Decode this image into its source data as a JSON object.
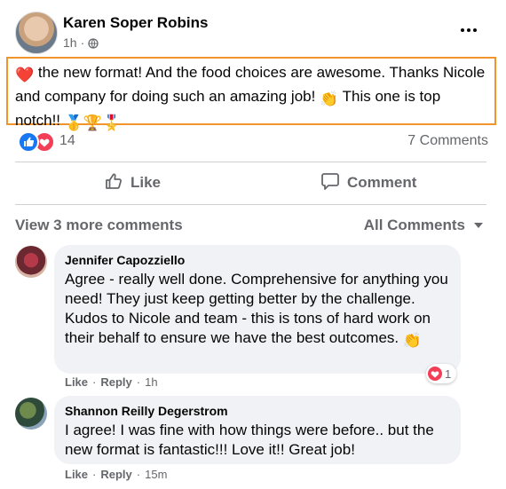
{
  "post": {
    "author": "Karen Soper Robins",
    "time": "1h",
    "separator": "·",
    "text_heart": "❤️",
    "text_part1": " the new format! And the food choices are awesome.  Thanks Nicole and company for doing such an amazing job! ",
    "text_clap": "👏",
    "text_part2": " This one is top notch!! ",
    "text_medals": "🥇🏆🎖️",
    "reaction_count": "14",
    "comment_count": "7 Comments"
  },
  "actions": {
    "like_label": "Like",
    "comment_label": "Comment"
  },
  "comments_header": {
    "view_more": "View 3 more comments",
    "filter": "All Comments"
  },
  "comments": [
    {
      "name": "Jennifer Capozziello",
      "text": "Agree - really well done. Comprehensive for anything you need! They just keep getting better by the challenge. Kudos to Nicole and team - this is tons of hard work on their behalf to ensure we have the best outcomes. ",
      "emoji": "👏",
      "like": "Like",
      "reply": "Reply",
      "time": "1h",
      "reaction_count": "1"
    },
    {
      "name": "Shannon Reilly Degerstrom",
      "text": "I agree! I was fine with how things were before.. but the new format is fantastic!!! Love it!! Great job!",
      "like": "Like",
      "reply": "Reply",
      "time": "15m"
    }
  ],
  "colors": {
    "highlight_border": "#f0942b",
    "like_blue": "#1877f2",
    "love_red": "#f33e58",
    "secondary_text": "#65676b"
  }
}
